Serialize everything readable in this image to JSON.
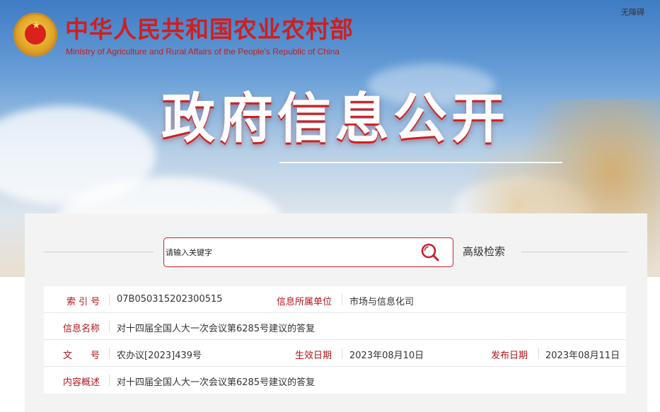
{
  "header": {
    "ministry_cn": "中华人民共和国农业农村部",
    "ministry_en": "Ministry of Agriculture and Rural Affairs of the People's Republic of China",
    "accessibility": "无障碍",
    "banner_title": "政府信息公开",
    "emblem_icon": "national-emblem-icon"
  },
  "search": {
    "placeholder": "请输入关键字",
    "button_icon": "search-icon",
    "advanced_label": "高级检索"
  },
  "info": {
    "index_label": "索 引 号",
    "index_value": "07B050315202300515",
    "unit_label": "信息所属单位",
    "unit_value": "市场与信息化司",
    "name_label": "信息名称",
    "name_value": "对十四届全国人大一次会议第6285号建议的答复",
    "doc_label": "文　　号",
    "doc_value": "农办议[2023]439号",
    "effective_label": "生效日期",
    "effective_value": "2023年08月10日",
    "publish_label": "发布日期",
    "publish_value": "2023年08月11日",
    "summary_label": "内容概述",
    "summary_value": "对十四届全国人大一次会议第6285号建议的答复"
  },
  "colors": {
    "brand_red": "#cf1f1f",
    "label_red": "#b2161b",
    "search_border": "#c8202b"
  }
}
